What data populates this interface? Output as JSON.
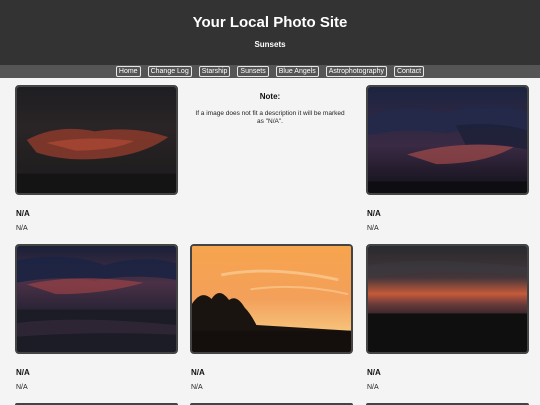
{
  "header": {
    "title": "Your Local Photo Site",
    "subtitle": "Sunsets"
  },
  "nav": {
    "links": [
      "Home",
      "Change Log",
      "Starship",
      "Sunsets",
      "Blue Angels",
      "Astrophotography",
      "Contact"
    ]
  },
  "note": {
    "title": "Note:",
    "text": "If a image does not fit a description it will be marked as \"N/A\"."
  },
  "photos": [
    {
      "title": "N/A",
      "description": "N/A"
    },
    {
      "title": "N/A",
      "description": "N/A"
    },
    {
      "title": "N/A",
      "description": "N/A"
    },
    {
      "title": "N/A",
      "description": "N/A"
    },
    {
      "title": "N/A",
      "description": "N/A"
    }
  ]
}
